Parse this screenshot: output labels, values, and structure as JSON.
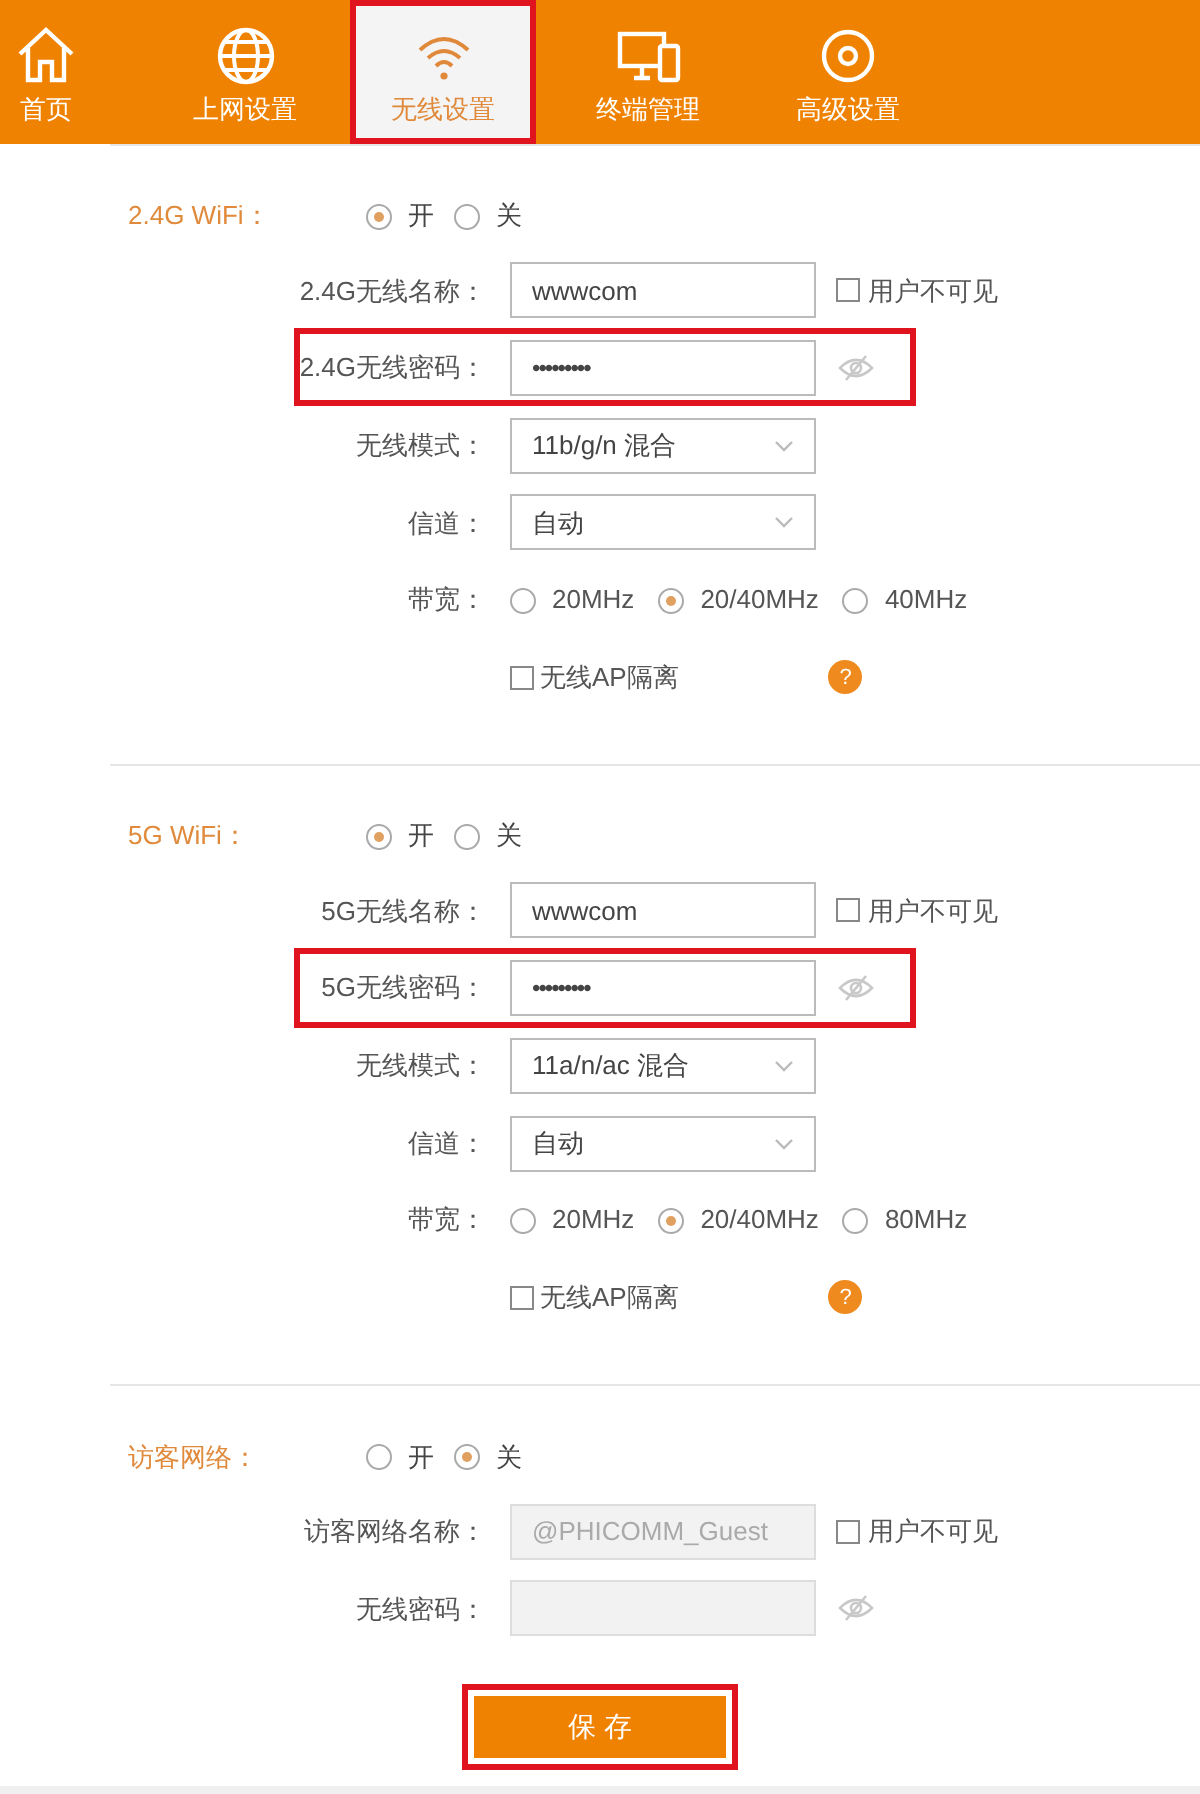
{
  "nav": [
    {
      "label": "首页",
      "selected": false,
      "highlighted": false
    },
    {
      "label": "上网设置",
      "selected": false,
      "highlighted": false
    },
    {
      "label": "无线设置",
      "selected": true,
      "highlighted": true
    },
    {
      "label": "终端管理",
      "selected": false,
      "highlighted": false
    },
    {
      "label": "高级设置",
      "selected": false,
      "highlighted": false
    }
  ],
  "sections": [
    {
      "title": "2.4G WiFi：",
      "radios": [
        {
          "label": "开",
          "selected": true
        },
        {
          "label": "关",
          "selected": false
        }
      ],
      "fields": [
        {
          "kind": "text",
          "label": "2.4G无线名称：",
          "value": "wwwcom",
          "disabled": false,
          "highlighted": false,
          "checkbox": {
            "label": "用户不可见",
            "checked": false
          }
        },
        {
          "kind": "password",
          "label": "2.4G无线密码：",
          "value": "•••••••••",
          "disabled": false,
          "highlighted": true
        },
        {
          "kind": "select",
          "label": "无线模式：",
          "value": "11b/g/n 混合"
        },
        {
          "kind": "select",
          "label": "信道：",
          "value": "自动"
        },
        {
          "kind": "radio",
          "label": "带宽：",
          "options": [
            {
              "label": "20MHz",
              "selected": false
            },
            {
              "label": "20/40MHz",
              "selected": true
            },
            {
              "label": "40MHz",
              "selected": false
            }
          ]
        },
        {
          "kind": "checkbox",
          "label": "无线AP隔离",
          "checked": false,
          "help": "?"
        }
      ]
    },
    {
      "title": "5G WiFi：",
      "radios": [
        {
          "label": "开",
          "selected": true
        },
        {
          "label": "关",
          "selected": false
        }
      ],
      "fields": [
        {
          "kind": "text",
          "label": "5G无线名称：",
          "value": "wwwcom",
          "disabled": false,
          "highlighted": false,
          "checkbox": {
            "label": "用户不可见",
            "checked": false
          }
        },
        {
          "kind": "password",
          "label": "5G无线密码：",
          "value": "•••••••••",
          "disabled": false,
          "highlighted": true
        },
        {
          "kind": "select",
          "label": "无线模式：",
          "value": "11a/n/ac 混合"
        },
        {
          "kind": "select",
          "label": "信道：",
          "value": "自动"
        },
        {
          "kind": "radio",
          "label": "带宽：",
          "options": [
            {
              "label": "20MHz",
              "selected": false
            },
            {
              "label": "20/40MHz",
              "selected": true
            },
            {
              "label": "80MHz",
              "selected": false
            }
          ]
        },
        {
          "kind": "checkbox",
          "label": "无线AP隔离",
          "checked": false,
          "help": "?"
        }
      ]
    },
    {
      "title": "访客网络：",
      "radios": [
        {
          "label": "开",
          "selected": false
        },
        {
          "label": "关",
          "selected": true
        }
      ],
      "fields": [
        {
          "kind": "text",
          "label": "访客网络名称：",
          "value": "@PHICOMM_Guest",
          "disabled": true,
          "highlighted": false,
          "checkbox": {
            "label": "用户不可见",
            "checked": false
          }
        },
        {
          "kind": "password",
          "label": "无线密码：",
          "disabled": true,
          "highlighted": false
        }
      ]
    }
  ],
  "save": {
    "label": "保 存",
    "highlighted": true
  }
}
